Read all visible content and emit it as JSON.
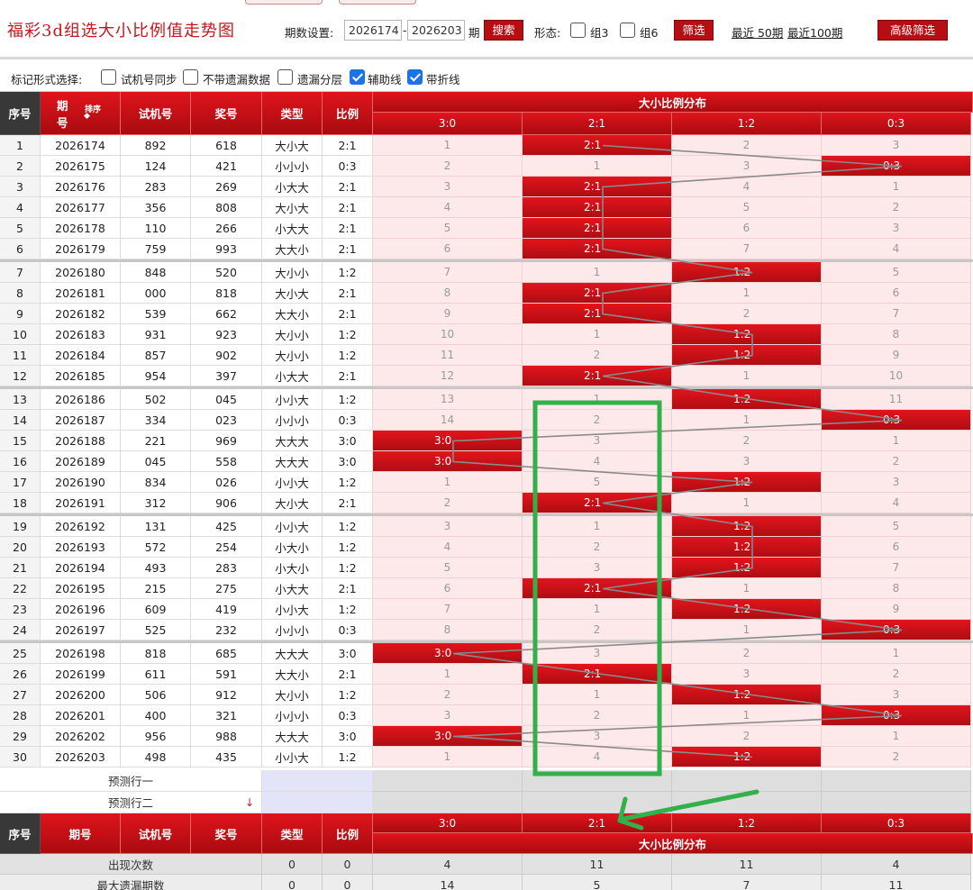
{
  "header": {
    "title": "福彩3d组选大小比例值走势图",
    "period_label": "期数设置:",
    "period_from": "2026174",
    "dash": "-",
    "period_to": "2026203",
    "period_unit": "期",
    "search_label": "搜索",
    "form_label": "形态:",
    "group3_label": "组3",
    "group6_label": "组6",
    "filter_label": "筛选",
    "recent50_label": "最近 50期",
    "recent100_label": "最近100期",
    "advanced_label": "高级筛选"
  },
  "markbar": {
    "label": "标记形式选择:",
    "options": [
      {
        "label": "试机号同步",
        "checked": false
      },
      {
        "label": "不带遗漏数据",
        "checked": false
      },
      {
        "label": "遗漏分层",
        "checked": false
      },
      {
        "label": "辅助线",
        "checked": true
      },
      {
        "label": "带折线",
        "checked": true
      }
    ]
  },
  "table": {
    "headers": {
      "index": "序号",
      "period": "期号",
      "period_top": "期",
      "period_bottom": "号",
      "sort": "排序",
      "trial": "试机号",
      "winning": "奖号",
      "type": "类型",
      "ratio": "比例",
      "dist_title": "大小比例分布"
    },
    "dist_columns": [
      "3:0",
      "2:1",
      "1:2",
      "0:3"
    ],
    "rows": [
      {
        "i": "1",
        "period": "2026174",
        "trial": "892",
        "win": "618",
        "type": "大小大",
        "ratio": "2:1",
        "d": [
          "1",
          "2:1",
          "2",
          "3"
        ],
        "hit": 1
      },
      {
        "i": "2",
        "period": "2026175",
        "trial": "124",
        "win": "421",
        "type": "小小小",
        "ratio": "0:3",
        "d": [
          "2",
          "1",
          "3",
          "0:3"
        ],
        "hit": 3
      },
      {
        "i": "3",
        "period": "2026176",
        "trial": "283",
        "win": "269",
        "type": "小大大",
        "ratio": "2:1",
        "d": [
          "3",
          "2:1",
          "4",
          "1"
        ],
        "hit": 1
      },
      {
        "i": "4",
        "period": "2026177",
        "trial": "356",
        "win": "808",
        "type": "大小大",
        "ratio": "2:1",
        "d": [
          "4",
          "2:1",
          "5",
          "2"
        ],
        "hit": 1
      },
      {
        "i": "5",
        "period": "2026178",
        "trial": "110",
        "win": "266",
        "type": "小大大",
        "ratio": "2:1",
        "d": [
          "5",
          "2:1",
          "6",
          "3"
        ],
        "hit": 1
      },
      {
        "i": "6",
        "period": "2026179",
        "trial": "759",
        "win": "993",
        "type": "大大小",
        "ratio": "2:1",
        "d": [
          "6",
          "2:1",
          "7",
          "4"
        ],
        "hit": 1
      },
      {
        "i": "7",
        "period": "2026180",
        "trial": "848",
        "win": "520",
        "type": "大小小",
        "ratio": "1:2",
        "d": [
          "7",
          "1",
          "1:2",
          "5"
        ],
        "hit": 2
      },
      {
        "i": "8",
        "period": "2026181",
        "trial": "000",
        "win": "818",
        "type": "大小大",
        "ratio": "2:1",
        "d": [
          "8",
          "2:1",
          "1",
          "6"
        ],
        "hit": 1
      },
      {
        "i": "9",
        "period": "2026182",
        "trial": "539",
        "win": "662",
        "type": "大大小",
        "ratio": "2:1",
        "d": [
          "9",
          "2:1",
          "2",
          "7"
        ],
        "hit": 1
      },
      {
        "i": "10",
        "period": "2026183",
        "trial": "931",
        "win": "923",
        "type": "大小小",
        "ratio": "1:2",
        "d": [
          "10",
          "1",
          "1:2",
          "8"
        ],
        "hit": 2
      },
      {
        "i": "11",
        "period": "2026184",
        "trial": "857",
        "win": "902",
        "type": "大小小",
        "ratio": "1:2",
        "d": [
          "11",
          "2",
          "1:2",
          "9"
        ],
        "hit": 2
      },
      {
        "i": "12",
        "period": "2026185",
        "trial": "954",
        "win": "397",
        "type": "小大大",
        "ratio": "2:1",
        "d": [
          "12",
          "2:1",
          "1",
          "10"
        ],
        "hit": 1
      },
      {
        "i": "13",
        "period": "2026186",
        "trial": "502",
        "win": "045",
        "type": "小小大",
        "ratio": "1:2",
        "d": [
          "13",
          "1",
          "1:2",
          "11"
        ],
        "hit": 2
      },
      {
        "i": "14",
        "period": "2026187",
        "trial": "334",
        "win": "023",
        "type": "小小小",
        "ratio": "0:3",
        "d": [
          "14",
          "2",
          "1",
          "0:3"
        ],
        "hit": 3
      },
      {
        "i": "15",
        "period": "2026188",
        "trial": "221",
        "win": "969",
        "type": "大大大",
        "ratio": "3:0",
        "d": [
          "3:0",
          "3",
          "2",
          "1"
        ],
        "hit": 0
      },
      {
        "i": "16",
        "period": "2026189",
        "trial": "045",
        "win": "558",
        "type": "大大大",
        "ratio": "3:0",
        "d": [
          "3:0",
          "4",
          "3",
          "2"
        ],
        "hit": 0
      },
      {
        "i": "17",
        "period": "2026190",
        "trial": "834",
        "win": "026",
        "type": "小小大",
        "ratio": "1:2",
        "d": [
          "1",
          "5",
          "1:2",
          "3"
        ],
        "hit": 2
      },
      {
        "i": "18",
        "period": "2026191",
        "trial": "312",
        "win": "906",
        "type": "大小大",
        "ratio": "2:1",
        "d": [
          "2",
          "2:1",
          "1",
          "4"
        ],
        "hit": 1
      },
      {
        "i": "19",
        "period": "2026192",
        "trial": "131",
        "win": "425",
        "type": "小小大",
        "ratio": "1:2",
        "d": [
          "3",
          "1",
          "1:2",
          "5"
        ],
        "hit": 2
      },
      {
        "i": "20",
        "period": "2026193",
        "trial": "572",
        "win": "254",
        "type": "小大小",
        "ratio": "1:2",
        "d": [
          "4",
          "2",
          "1:2",
          "6"
        ],
        "hit": 2
      },
      {
        "i": "21",
        "period": "2026194",
        "trial": "493",
        "win": "283",
        "type": "小大小",
        "ratio": "1:2",
        "d": [
          "5",
          "3",
          "1:2",
          "7"
        ],
        "hit": 2
      },
      {
        "i": "22",
        "period": "2026195",
        "trial": "215",
        "win": "275",
        "type": "小大大",
        "ratio": "2:1",
        "d": [
          "6",
          "2:1",
          "1",
          "8"
        ],
        "hit": 1
      },
      {
        "i": "23",
        "period": "2026196",
        "trial": "609",
        "win": "419",
        "type": "小小大",
        "ratio": "1:2",
        "d": [
          "7",
          "1",
          "1:2",
          "9"
        ],
        "hit": 2
      },
      {
        "i": "24",
        "period": "2026197",
        "trial": "525",
        "win": "232",
        "type": "小小小",
        "ratio": "0:3",
        "d": [
          "8",
          "2",
          "1",
          "0:3"
        ],
        "hit": 3
      },
      {
        "i": "25",
        "period": "2026198",
        "trial": "818",
        "win": "685",
        "type": "大大大",
        "ratio": "3:0",
        "d": [
          "3:0",
          "3",
          "2",
          "1"
        ],
        "hit": 0
      },
      {
        "i": "26",
        "period": "2026199",
        "trial": "611",
        "win": "591",
        "type": "大大小",
        "ratio": "2:1",
        "d": [
          "1",
          "2:1",
          "3",
          "2"
        ],
        "hit": 1
      },
      {
        "i": "27",
        "period": "2026200",
        "trial": "506",
        "win": "912",
        "type": "大小小",
        "ratio": "1:2",
        "d": [
          "2",
          "1",
          "1:2",
          "3"
        ],
        "hit": 2
      },
      {
        "i": "28",
        "period": "2026201",
        "trial": "400",
        "win": "321",
        "type": "小小小",
        "ratio": "0:3",
        "d": [
          "3",
          "2",
          "1",
          "0:3"
        ],
        "hit": 3
      },
      {
        "i": "29",
        "period": "2026202",
        "trial": "956",
        "win": "988",
        "type": "大大大",
        "ratio": "3:0",
        "d": [
          "3:0",
          "3",
          "2",
          "1"
        ],
        "hit": 0
      },
      {
        "i": "30",
        "period": "2026203",
        "trial": "498",
        "win": "435",
        "type": "小小大",
        "ratio": "1:2",
        "d": [
          "1",
          "4",
          "1:2",
          "2"
        ],
        "hit": 2
      }
    ],
    "predict": [
      "预测行一",
      "预测行二"
    ],
    "stats": [
      {
        "label": "出现次数",
        "type": "0",
        "ratio": "0",
        "values": [
          "4",
          "11",
          "11",
          "4"
        ]
      },
      {
        "label": "最大遗漏期数",
        "type": "0",
        "ratio": "0",
        "values": [
          "14",
          "5",
          "7",
          "11"
        ]
      }
    ]
  },
  "annotation": {
    "color": "#32b04a",
    "target_column": "2:1",
    "rows_from": 14,
    "rows_to": 30
  },
  "colors": {
    "accent": "#c8151b",
    "hit_cell": "#d0121a",
    "dist_bg": "#fde9ea",
    "trend_line": "#8a8a8a"
  }
}
